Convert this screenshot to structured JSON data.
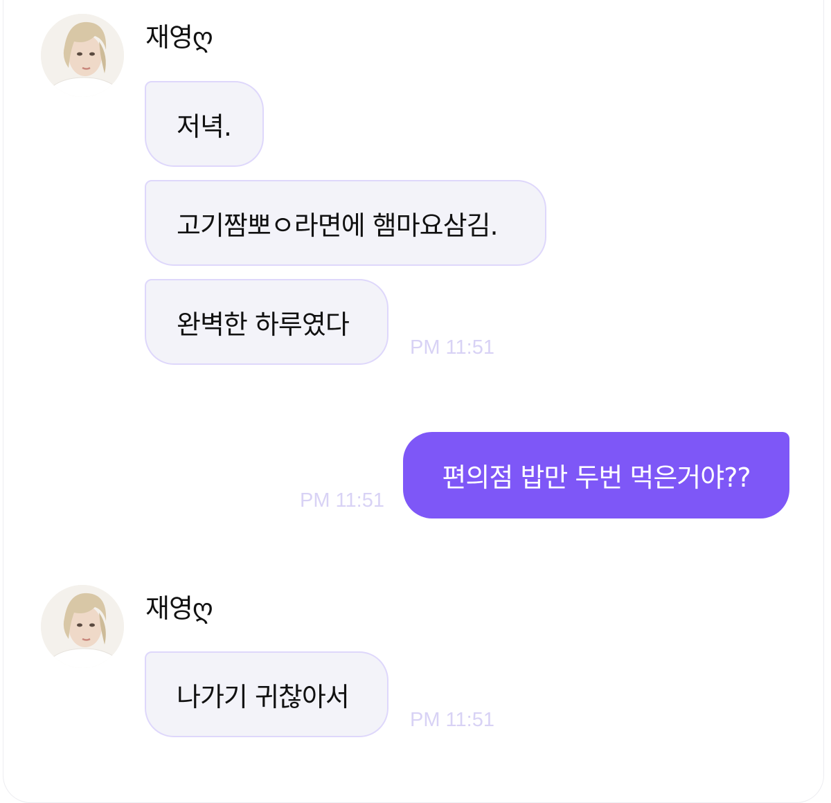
{
  "groups": [
    {
      "sender": "재영ღ",
      "messages": [
        {
          "text": "저녁."
        },
        {
          "text": "고기짬뽀ㅇ라면에 햄마요삼김."
        },
        {
          "text": "완벽한 하루였다"
        }
      ],
      "time": "PM 11:51"
    },
    {
      "outgoing": true,
      "messages": [
        {
          "text": "편의점 밥만 두번 먹은거야??"
        }
      ],
      "time": "PM 11:51"
    },
    {
      "sender": "재영ღ",
      "messages": [
        {
          "text": "나가기 귀찮아서"
        }
      ],
      "time": "PM 11:51"
    }
  ],
  "colors": {
    "incoming_bubble": "#f3f3f9",
    "incoming_border": "#ded7fb",
    "outgoing_bubble": "#7e57f7",
    "timestamp": "#d8d2f5"
  },
  "icons": {
    "avatar": "profile-photo"
  }
}
